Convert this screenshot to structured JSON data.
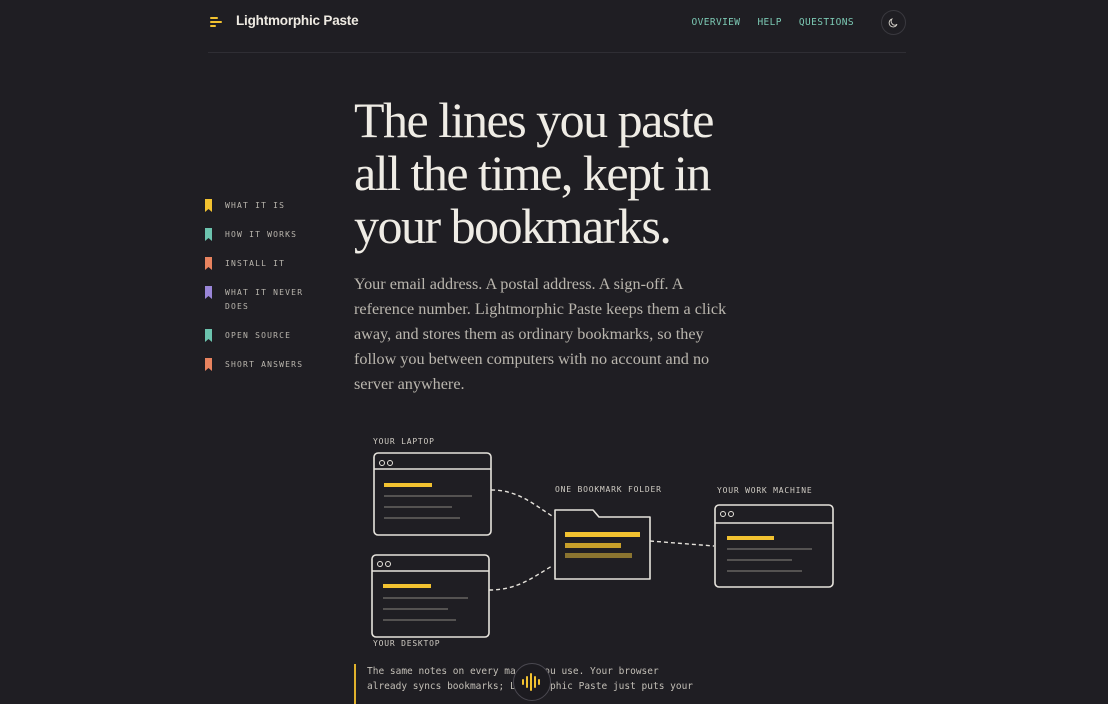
{
  "header": {
    "brand": "Lightmorphic Paste",
    "nav": [
      "OVERVIEW",
      "HELP",
      "QUESTIONS"
    ],
    "theme_icon": "moon-icon"
  },
  "toc": [
    {
      "label": "WHAT IT IS",
      "color": "#f2c230"
    },
    {
      "label": "HOW IT WORKS",
      "color": "#6cc3ae"
    },
    {
      "label": "INSTALL IT",
      "color": "#e8835f"
    },
    {
      "label": "WHAT IT NEVER DOES",
      "color": "#9a86d8"
    },
    {
      "label": "OPEN SOURCE",
      "color": "#6cc3ae"
    },
    {
      "label": "SHORT ANSWERS",
      "color": "#e8835f"
    }
  ],
  "hero": {
    "title_lines": [
      "The lines you paste",
      "all the time, kept in",
      "your bookmarks."
    ],
    "lede": "Your email address. A postal address. A sign-off. A reference number. Lightmorphic Paste keeps them a click away, and stores them as ordinary bookmarks, so they follow you between computers with no account and no server anywhere."
  },
  "diagram": {
    "laptop": "YOUR LAPTOP",
    "desktop": "YOUR DESKTOP",
    "folder": "ONE BOOKMARK FOLDER",
    "work": "YOUR WORK MACHINE"
  },
  "note": {
    "line1": "The same notes on every ma    you use. Your browser",
    "line2": "already syncs bookmarks; L    orphic Paste just puts your"
  },
  "colors": {
    "accent": "#f2c230",
    "nav": "#7cc9b4",
    "background": "#1f1e23"
  }
}
